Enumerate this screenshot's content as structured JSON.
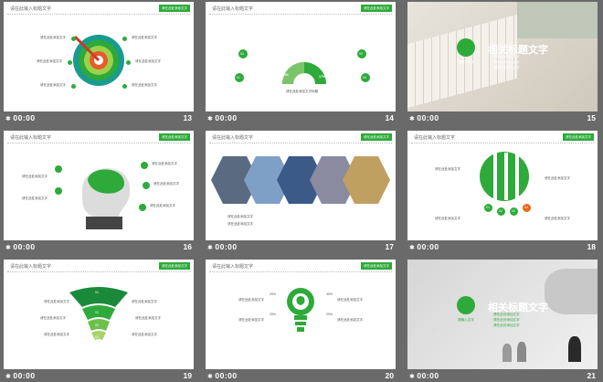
{
  "colors": {
    "accent": "#2eaa3a",
    "selection": "#e86a10",
    "background": "#6a6a6a"
  },
  "slides": [
    {
      "num": "13",
      "time": "00:00",
      "header": "请在此输入标题文字",
      "tag": "请在此处添加文字",
      "text": "请在此处添加文字"
    },
    {
      "num": "14",
      "time": "00:00",
      "header": "请在此输入标题文字",
      "tag": "请在此处添加文字",
      "text": "请在此处添加文字",
      "center_caption": "请在此处添加文字标题",
      "stats": [
        "02",
        "03",
        "01",
        "04"
      ],
      "percents": [
        "15%",
        "29%",
        "73%",
        "17%"
      ]
    },
    {
      "num": "15",
      "time": "00:00",
      "title": "相关标题文字",
      "subtitle": "请输入文字",
      "items": [
        "请在此处添加文字",
        "请在此处添加文字",
        "请在此处添加文字"
      ]
    },
    {
      "num": "16",
      "time": "00:00",
      "header": "请在此输入标题文字",
      "tag": "请在此处添加文字",
      "text": "请在此处添加文字"
    },
    {
      "num": "17",
      "time": "00:00",
      "header": "请在此输入标题文字",
      "tag": "请在此处添加文字",
      "caption": "请在此处添加文字"
    },
    {
      "num": "18",
      "time": "00:00",
      "header": "请在此输入标题文字",
      "tag": "请在此处添加文字",
      "steps": [
        "01",
        "02",
        "03",
        "04"
      ],
      "text": "请在此处添加文字"
    },
    {
      "num": "19",
      "time": "00:00",
      "header": "请在此输入标题文字",
      "tag": "请在此处添加文字",
      "levels": [
        "01",
        "02",
        "03",
        "04"
      ],
      "text": "请在此处添加文字"
    },
    {
      "num": "20",
      "time": "00:00",
      "header": "请在此输入标题文字",
      "tag": "请在此处添加文字",
      "percents": [
        "20%",
        "20%",
        "30%",
        "20%"
      ],
      "text": "请在此处添加文字"
    },
    {
      "num": "21",
      "time": "00:00",
      "title": "相关标题文字",
      "subtitle": "请输入文字",
      "items": [
        "请在此处添加文字",
        "请在此处添加文字",
        "请在此处添加文字"
      ]
    }
  ]
}
